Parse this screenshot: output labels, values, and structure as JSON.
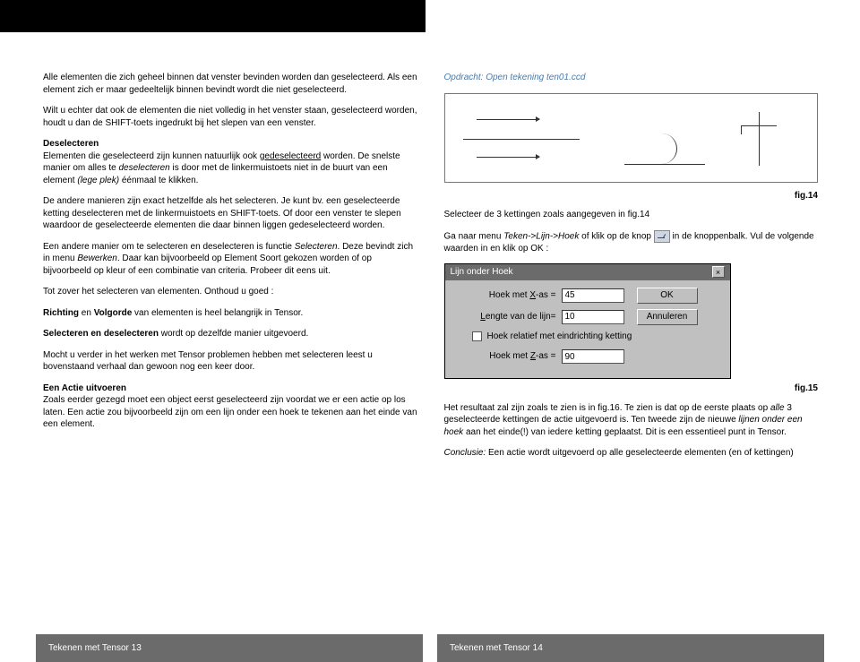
{
  "left": {
    "p1": "Alle elementen die zich geheel binnen dat venster bevinden worden dan geselecteerd. Als een element zich er maar gedeeltelijk binnen bevindt wordt die niet geselecteerd.",
    "p2": "Wilt u echter dat ook de elementen die niet volledig in het venster staan, geselecteerd worden, houdt u dan de SHIFT-toets ingedrukt bij het slepen van een venster.",
    "h_desel": "Deselecteren",
    "p3a": "Elementen die geselecteerd zijn kunnen natuurlijk ook ",
    "p3b": "gedeselecteerd",
    "p3c": " worden. De snelste manier om alles te ",
    "p3d": "deselecteren",
    "p3e": " is door met de linkermuistoets niet in de buurt van een element ",
    "p3f": "(lege plek)",
    "p3g": " éénmaal te klikken.",
    "p4": "De andere manieren zijn exact hetzelfde als het selecteren. Je kunt bv. een geselecteerde ketting deselecteren met de linkermuistoets en SHIFT-toets. Of door een venster te slepen waardoor de geselecteerde elementen die daar binnen liggen gedeselecteerd worden.",
    "p5a": "Een andere manier om te selecteren en deselecteren is functie ",
    "p5b": "Selecteren",
    "p5c": ". Deze bevindt zich in menu ",
    "p5d": "Bewerken",
    "p5e": ". Daar kan bijvoorbeeld op Element Soort gekozen worden of op bijvoorbeeld op kleur of een combinatie van criteria. Probeer dit eens uit.",
    "p6": "Tot zover het selecteren van elementen. Onthoud u goed :",
    "p7a": "Richting",
    "p7b": " en ",
    "p7c": "Volgorde",
    "p7d": " van elementen is heel belangrijk in Tensor.",
    "p8a": "Selecteren en deselecteren",
    "p8b": " wordt op dezelfde manier uitgevoerd.",
    "p9": "Mocht u verder in het werken met Tensor problemen hebben met selecteren leest u bovenstaand verhaal dan gewoon nog een keer door.",
    "h_actie": "Een Actie uitvoeren",
    "p10": "Zoals eerder gezegd moet een object eerst geselecteerd zijn voordat we er een actie op los laten. Een actie zou bijvoorbeeld zijn om een lijn onder een hoek te tekenen aan het einde van een element.",
    "footer": "Tekenen met Tensor 13"
  },
  "right": {
    "assignment": "Opdracht: Open tekening ten01.ccd",
    "fig14": "fig.14",
    "p1": "Selecteer de 3 kettingen zoals aangegeven in fig.14",
    "p2a": "Ga naar menu ",
    "p2b": "Teken->Lijn->Hoek",
    "p2c": " of klik op de knop ",
    "p2d": " in de knoppenbalk. Vul de volgende waarden in en klik op OK :",
    "dialog": {
      "title": "Lijn onder Hoek",
      "hoekx_label_pre": "Hoek met ",
      "hoekx_hot": "X",
      "hoekx_label_post": "-as =",
      "hoekx_val": "45",
      "lengte_hot": "L",
      "lengte_label": "engte van de lijn=",
      "lengte_val": "10",
      "chk_hot": "H",
      "chk_label": "oek relatief met eindrichting ketting",
      "hoekz_label_pre": "Hoek met ",
      "hoekz_hot": "Z",
      "hoekz_label_post": "-as =",
      "hoekz_val": "90",
      "ok": "OK",
      "annul": "Annuleren"
    },
    "fig15": "fig.15",
    "p3a": "Het resultaat zal zijn zoals te zien is in fig.16. Te zien is dat op de eerste plaats op ",
    "p3b": "alle",
    "p3c": " 3 geselecteerde kettingen de actie uitgevoerd is. Ten tweede zijn de nieuwe ",
    "p3d": "lijnen onder een hoek",
    "p3e": " aan het einde(!) van iedere ketting geplaatst. Dit is een essentieel punt in Tensor.",
    "p4a": "Conclusie:",
    "p4b": " Een actie wordt uitgevoerd op alle geselecteerde elementen (en of kettingen)",
    "footer": "Tekenen met Tensor 14"
  }
}
